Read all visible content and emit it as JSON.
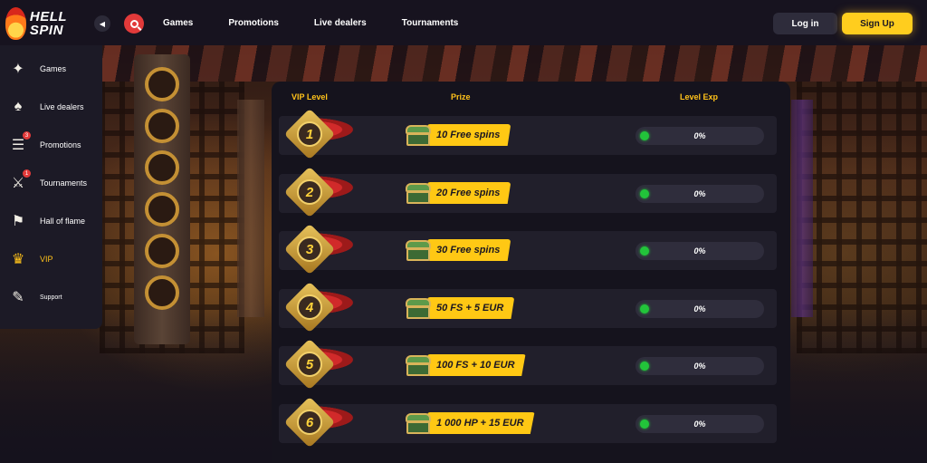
{
  "brand": {
    "name": "HELL SPIN"
  },
  "nav": {
    "items": [
      "Games",
      "Promotions",
      "Live dealers",
      "Tournaments"
    ]
  },
  "auth": {
    "login": "Log in",
    "signup": "Sign Up"
  },
  "sidebar": {
    "items": [
      {
        "label": "Games",
        "icon": "dice-icon"
      },
      {
        "label": "Live dealers",
        "icon": "dealer-icon"
      },
      {
        "label": "Promotions",
        "icon": "scroll-icon",
        "badge": "3"
      },
      {
        "label": "Tournaments",
        "icon": "shield-swords-icon",
        "badge": "1"
      },
      {
        "label": "Hall of flame",
        "icon": "banner-icon"
      },
      {
        "label": "VIP",
        "icon": "crown-icon"
      },
      {
        "label": "Support",
        "icon": "feather-icon"
      }
    ]
  },
  "vip": {
    "headers": {
      "level": "VIP Level",
      "prize": "Prize",
      "exp": "Level Exp"
    },
    "rows": [
      {
        "level": "1",
        "prize": "10 Free spins",
        "progress": "0%"
      },
      {
        "level": "2",
        "prize": "20 Free spins",
        "progress": "0%"
      },
      {
        "level": "3",
        "prize": "30 Free spins",
        "progress": "0%"
      },
      {
        "level": "4",
        "prize": "50 FS  +  5 EUR",
        "progress": "0%"
      },
      {
        "level": "5",
        "prize": "100 FS  +  10 EUR",
        "progress": "0%"
      },
      {
        "level": "6",
        "prize": "1 000 HP  +  15 EUR",
        "progress": "0%"
      }
    ]
  },
  "colors": {
    "accent": "#ffc814",
    "danger": "#e23a3a",
    "progress_dot": "#22c43a"
  }
}
